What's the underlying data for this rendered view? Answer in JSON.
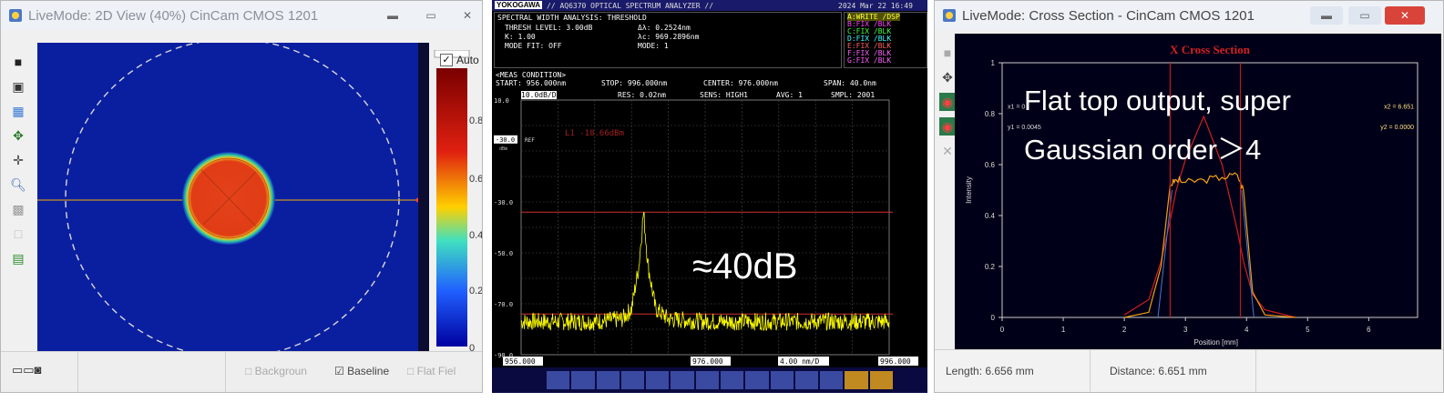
{
  "panel_left": {
    "title": "LiveMode: 2D View (40%)   CinCam CMOS 1201",
    "auto_label": "Auto",
    "colorbar_ticks": [
      "0.8",
      "0.6",
      "0.4",
      "0.2",
      "0"
    ],
    "status_options": [
      "Backgroun",
      "Baseline",
      "Flat Fiel"
    ],
    "colors": {
      "background_blue": "#0a1fa0",
      "spot_red": "#e2381a"
    }
  },
  "panel_middle": {
    "brand": "YOKOGAWA",
    "title": "// AQ6370 OPTICAL SPECTRUM ANALYZER //",
    "datetime": "2024 Mar 22 16:49",
    "analysis_line": "SPECTRAL WIDTH ANALYSIS: THRESHOLD",
    "thresh": "THRESH LEVEL: 3.00dB",
    "k": "K: 1.00",
    "mode_fit": "MODE FIT: OFF",
    "dl": "Δλ: 0.2524nm",
    "lc": "λc: 969.2896nm",
    "mode_no": "MODE: 1",
    "meas_condition": "<MEAS CONDITION>",
    "start": "START: 956.000nm",
    "stop": "STOP: 996.000nm",
    "center": "CENTER: 976.000nm",
    "span": "SPAN: 40.0nm",
    "scale": "10.0dB/D",
    "res": "RES: 0.02nm",
    "sens": "SENS: HIGH1",
    "avg": "AVG: 1",
    "smpl": "SMPL: 2001",
    "ref_level": "-30.0",
    "ref_unit": "dBm",
    "ref_label": "REF",
    "y_ticks": [
      "10.0",
      "-30.0",
      "-50.0",
      "-70.0",
      "-90.0"
    ],
    "x_left": "956.000",
    "x_center": "976.000",
    "x_right": "996.000",
    "div": "4.00 nm/D",
    "marker_text": "L1  -18.66dBm",
    "annotation": "≈40dB",
    "trace_legend": [
      "A:WRITE",
      "B:FIX",
      "C:FIX",
      "D:FIX",
      "E:FIX",
      "F:FIX",
      "G:FIX"
    ],
    "trace_state": [
      "/DSP",
      "/BLK",
      "/BLK",
      "/BLK",
      "/BLK",
      "/BLK",
      "/BLK"
    ],
    "colors": {
      "trace": "#ffff00",
      "grid": "#4a4a4a",
      "marker": "#d03030"
    }
  },
  "panel_right": {
    "title": "LiveMode: Cross Section - CinCam CMOS 1201",
    "plot_title": "X Cross Section",
    "annotation_line1": "Flat top output, super",
    "annotation_line2": "Gaussian order＞4",
    "y_label": "Intensity",
    "x_label": "Position [mm]",
    "y_ticks": [
      "1",
      "0.8",
      "0.6",
      "0.4",
      "0.2",
      "0"
    ],
    "x_ticks": [
      "0",
      "1",
      "2",
      "3",
      "4",
      "5",
      "6"
    ],
    "cursor_left": [
      "x1 = 0",
      "y1 = 0.0045"
    ],
    "cursor_right": [
      "x2 = 6.651",
      "y2 = 0.0000"
    ],
    "length": "Length: 6.656 mm",
    "distance": "Distance: 6.651 mm",
    "colors": {
      "measured": "#f2a010",
      "fit": "#d02020",
      "cursor": "#c01818",
      "plot_bg": "#000018"
    }
  },
  "chart_data": [
    {
      "type": "line",
      "title": "",
      "x": [
        956,
        960,
        964,
        967,
        968,
        968.8,
        969.3,
        969.8,
        970.6,
        972,
        976,
        984,
        996
      ],
      "series": [
        {
          "values": [
            -77,
            -77,
            -77,
            -76,
            -72,
            -55,
            -34,
            -55,
            -72,
            -76,
            -77,
            -77,
            -77
          ]
        }
      ],
      "xlabel": "",
      "ylabel": "",
      "xlim": [
        956,
        996
      ],
      "ylim": [
        -90,
        10
      ],
      "annotations": [
        "≈40dB"
      ]
    },
    {
      "type": "line",
      "title": "X Cross Section",
      "x": [
        2.0,
        2.4,
        2.6,
        2.75,
        2.85,
        3.0,
        3.3,
        3.6,
        3.85,
        3.95,
        4.1,
        4.3,
        4.8
      ],
      "series": [
        {
          "values": [
            0,
            0.02,
            0.2,
            0.52,
            0.54,
            0.53,
            0.54,
            0.55,
            0.56,
            0.5,
            0.1,
            0.01,
            0
          ]
        },
        {
          "values": [
            0.01,
            0.07,
            0.22,
            0.38,
            0.5,
            0.62,
            0.79,
            0.6,
            0.34,
            0.22,
            0.09,
            0.03,
            0
          ]
        }
      ],
      "xlabel": "Position [mm]",
      "ylabel": "Intensity",
      "xlim": [
        0,
        6.8
      ],
      "ylim": [
        0,
        1
      ],
      "annotations": [
        "Flat top output, super",
        "Gaussian order＞4"
      ]
    }
  ]
}
